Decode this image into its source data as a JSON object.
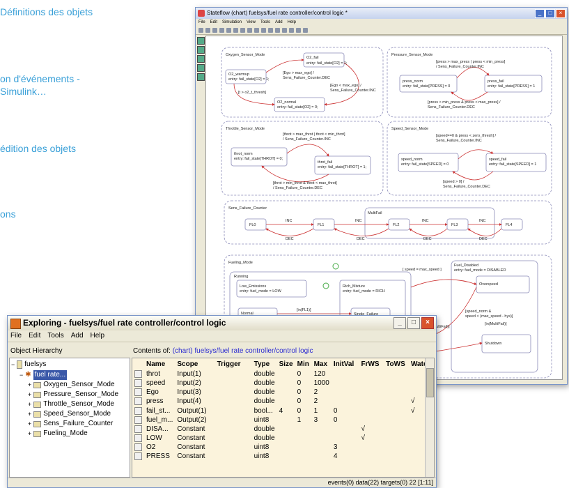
{
  "side_texts": [
    "Définitions des objets",
    "on d'événements -",
    "Simulink…",
    "édition des objets",
    "ons"
  ],
  "stateflow": {
    "title": "Stateflow (chart) fuelsys/fuel rate controller/control logic *",
    "menu": [
      "File",
      "Edit",
      "Simulation",
      "View",
      "Tools",
      "Add",
      "Help"
    ],
    "states": {
      "oxygen": "Oxygen_Sensor_Mode",
      "o2_fail": "O2_fail",
      "o2_fail_entry": "entry: fail_state[O2] = 1;",
      "o2_warmup": "O2_warmup",
      "o2_warmup_entry": "entry: fail_state[O2] = 1;",
      "o2_normal": "O2_normal",
      "o2_normal_entry": "entry: fail_state[O2] = 0;",
      "pressure": "Pressure_Sensor_Mode",
      "press_norm": "press_norm",
      "press_norm_entry": "entry: fail_state[PRESS] = 0",
      "press_fail": "press_fail",
      "press_fail_entry": "entry: fail_state[PRESS] = 1",
      "throttle": "Throttle_Sensor_Mode",
      "throt_norm": "throt_norm",
      "throt_norm_entry": "entry: fail_state[THROT] = 0;",
      "throt_fail": "throt_fail",
      "throt_fail_entry": "entry: fail_state[THROT] = 1;",
      "speed": "Speed_Sensor_Mode",
      "speed_norm": "speed_norm",
      "speed_norm_entry": "entry: fail_state[SPEED] = 0",
      "speed_fail": "speed_fail",
      "speed_fail_entry": "entry: fail_state[SPEED] = 1",
      "sens": "Sens_Failure_Counter",
      "fl0": "FL0",
      "fl1": "FL1",
      "multifail": "MultiFail",
      "fl2": "FL2",
      "fl3": "FL3",
      "fl4": "FL4",
      "inc": "INC",
      "dec": "DEC",
      "fueling": "Fueling_Mode",
      "running": "Running",
      "low_emissions": "Low_Emissions",
      "low_entry": "entry: fuel_mode = LOW",
      "normal": "Normal",
      "rich": "Rich_Mixture",
      "rich_entry": "entry: fuel_mode = RICH",
      "single_failure": "Single_Failure",
      "fuel_disabled": "Fuel_Disabled",
      "fuel_disabled_entry": "entry: fuel_mode = DISABLED",
      "overspeed": "Overspeed",
      "shutdown": "Shutdown",
      "speed_cond": "[ speed = max_speed ]",
      "multifail_cond": "[in(MultiFail)]",
      "flt1": "[in(FL1)]"
    },
    "transitions": {
      "ego": "[Ego > max_ego] /",
      "ego_dec": "Sens_Failure_Counter.DEC",
      "ego2": "[Ego < max_ego] /",
      "ego2_inc": "Sens_Failure_Counter.INC",
      "t_thresh": "[t > o2_t_thresh]",
      "press_cond": "[press > max_press | press < min_press]",
      "press_inc": "/ Sens_Failure_Counter.INC",
      "press_cond2": "[press > min_press & press < max_press] /",
      "press_dec": "Sens_Failure_Counter.DEC",
      "throt_cond": "[throt > max_throt | throt < min_throt]",
      "throt_inc": "/ Sens_Failure_Counter.INC",
      "throt_cond2": "[throt > min_throt & throt < max_throt]",
      "throt_dec": "/ Sens_Failure_Counter.DEC",
      "speed_cond": "[speed==0 & press < zero_thresh] /",
      "speed_inc": "Sens_Failure_Counter.INC",
      "speed_cond2": "[speed > 0] /",
      "speed_dec": "Sens_Failure_Counter.DEC",
      "reset": "[speed_norm &",
      "reset2": "speed < (max_speed - hys)]"
    }
  },
  "explorer": {
    "title": "Exploring - fuelsys/fuel rate controller/control logic",
    "menu": [
      "File",
      "Edit",
      "Tools",
      "Add",
      "Help"
    ],
    "left_header": "Object Hierarchy",
    "right_header_prefix": "Contents of:",
    "right_header_path": "(chart) fuelsys/fuel rate controller/control logic",
    "tree": [
      "fuelsys",
      "fuel rate...",
      "Oxygen_Sensor_Mode",
      "Pressure_Sensor_Mode",
      "Throttle_Sensor_Mode",
      "Speed_Sensor_Mode",
      "Sens_Failure_Counter",
      "Fueling_Mode"
    ],
    "columns": [
      "Name",
      "Scope",
      "Trigger",
      "Type",
      "Size",
      "Min",
      "Max",
      "InitVal",
      "FrWS",
      "ToWS",
      "Watch"
    ],
    "rows": [
      [
        "throt",
        "Input(1)",
        "",
        "double",
        "",
        "0",
        "120",
        "",
        "",
        "",
        ""
      ],
      [
        "speed",
        "Input(2)",
        "",
        "double",
        "",
        "0",
        "1000",
        "",
        "",
        "",
        ""
      ],
      [
        "Ego",
        "Input(3)",
        "",
        "double",
        "",
        "0",
        "2",
        "",
        "",
        "",
        ""
      ],
      [
        "press",
        "Input(4)",
        "",
        "double",
        "",
        "0",
        "2",
        "",
        "",
        "",
        "√"
      ],
      [
        "fail_st...",
        "Output(1)",
        "",
        "bool...",
        "4",
        "0",
        "1",
        "0",
        "",
        "",
        "√"
      ],
      [
        "fuel_m...",
        "Output(2)",
        "",
        "uint8",
        "",
        "1",
        "3",
        "0",
        "",
        "",
        ""
      ],
      [
        "DISA...",
        "Constant",
        "",
        "double",
        "",
        "",
        "",
        "",
        "√",
        "",
        ""
      ],
      [
        "LOW",
        "Constant",
        "",
        "double",
        "",
        "",
        "",
        "",
        "√",
        "",
        ""
      ],
      [
        "O2",
        "Constant",
        "",
        "uint8",
        "",
        "",
        "",
        "3",
        "",
        "",
        ""
      ],
      [
        "PRESS",
        "Constant",
        "",
        "uint8",
        "",
        "",
        "",
        "4",
        "",
        "",
        ""
      ]
    ],
    "status": "events(0) data(22) targets(0)  22  [1:11]"
  }
}
